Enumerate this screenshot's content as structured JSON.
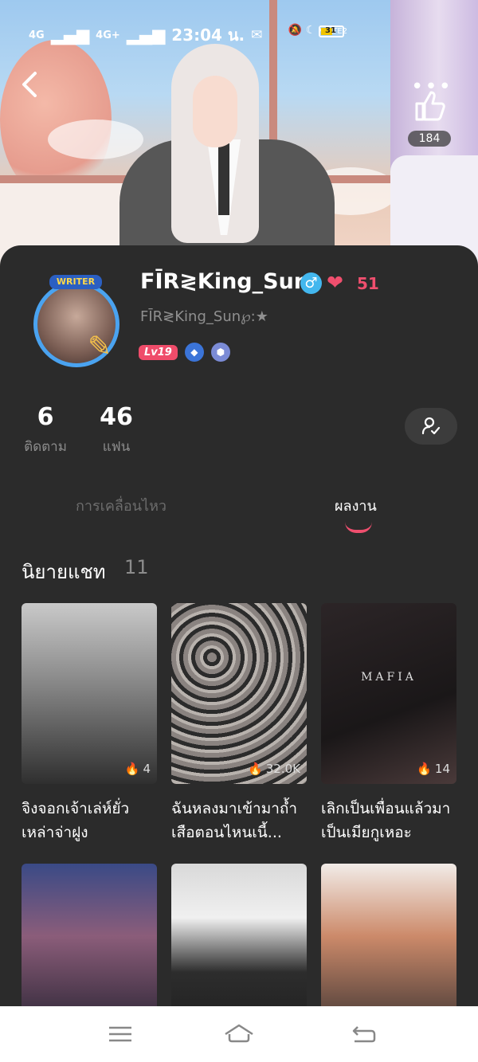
{
  "status_bar": {
    "network_1": "4G",
    "network_2": "4G+",
    "time": "23:04 น.",
    "right_icons": "VoLTE2",
    "battery": "31"
  },
  "header": {
    "like_count": "184"
  },
  "profile": {
    "avatar_tag": "WRITER",
    "username": "FĪR≷King_Sun",
    "gender_symbol": "♂",
    "hearts": "51",
    "subtitle": "FĪR≷King_Sun℘:★",
    "level": "Lv19"
  },
  "stats": {
    "following_count": "6",
    "following_label": "ติดตาม",
    "fans_count": "46",
    "fans_label": "แฟน"
  },
  "tabs": [
    {
      "label": "การเคลื่อนไหว",
      "active": false
    },
    {
      "label": "ผลงาน",
      "active": true
    }
  ],
  "section": {
    "title": "นิยายแชท",
    "count": "11"
  },
  "stories": [
    {
      "title": "จิงจอกเจ้าเล่ห์ยั่วเหล่าจ่าฝูง",
      "views": "4"
    },
    {
      "title": "ฉันหลงมาเข้ามาถ้ำเสือตอนไหนเนี้...",
      "views": "32.0K"
    },
    {
      "title": "เลิกเป็นเพื่อนแล้วมาเป็นเมียกูเหอะ",
      "views": "14",
      "cover_text": "MAFIA"
    },
    {
      "title": "",
      "views": ""
    },
    {
      "title": "",
      "views": ""
    },
    {
      "title": "",
      "views": ""
    }
  ],
  "colors": {
    "accent": "#ef4f6e",
    "background": "#2b2b2b",
    "gender_badge": "#43b7ee"
  }
}
